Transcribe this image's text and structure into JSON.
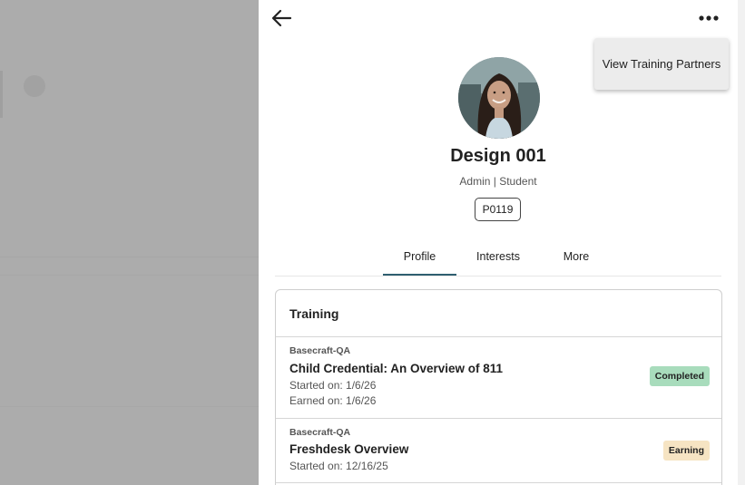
{
  "menu": {
    "view_training_partners": "View Training Partners"
  },
  "profile": {
    "name": "Design 001",
    "roles": "Admin | Student",
    "id_code": "P0119"
  },
  "tabs": [
    {
      "label": "Profile",
      "active": true
    },
    {
      "label": "Interests",
      "active": false
    },
    {
      "label": "More",
      "active": false
    }
  ],
  "training": {
    "title": "Training",
    "items": [
      {
        "org": "Basecraft-QA",
        "title": "Child Credential: An Overview of 811",
        "started": "Started on: 1/6/26",
        "earned": "Earned on: 1/6/26",
        "status": "Completed",
        "status_color": "#a8dcbc"
      },
      {
        "org": "Basecraft-QA",
        "title": "Freshdesk Overview",
        "started": "Started on: 12/16/25",
        "status": "Earning",
        "status_color": "#f6e4c3"
      }
    ]
  },
  "icons": {
    "back": "arrow-left-icon",
    "more": "more-horizontal-icon"
  },
  "colors": {
    "active_tab_underline": "#2f5f70",
    "overlay": "#acacac"
  }
}
